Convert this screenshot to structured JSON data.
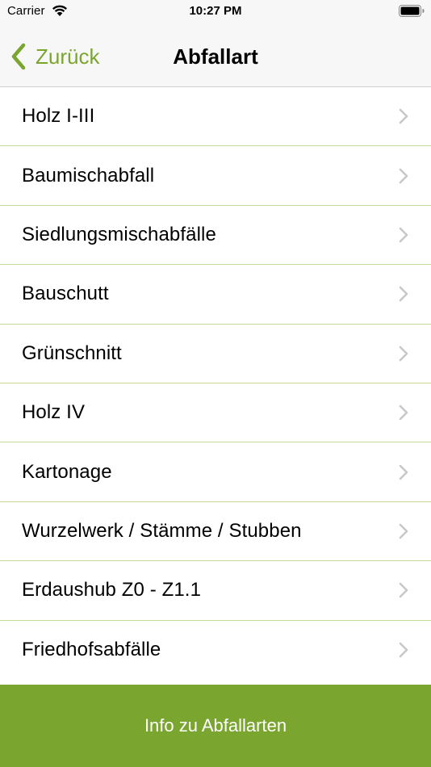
{
  "status_bar": {
    "carrier": "Carrier",
    "time": "10:27 PM",
    "icons": [
      "wifi-icon",
      "battery-icon"
    ]
  },
  "nav": {
    "back_label": "Zurück",
    "title": "Abfallart",
    "back_icon": "chevron-left-icon"
  },
  "list": {
    "items": [
      {
        "label": "Holz I-III"
      },
      {
        "label": "Baumischabfall"
      },
      {
        "label": "Siedlungsmischabfälle"
      },
      {
        "label": "Bauschutt"
      },
      {
        "label": "Grünschnitt"
      },
      {
        "label": "Holz IV"
      },
      {
        "label": "Kartonage"
      },
      {
        "label": "Wurzelwerk / Stämme / Stubben"
      },
      {
        "label": "Erdaushub Z0 - Z1.1"
      },
      {
        "label": "Friedhofsabfälle"
      }
    ],
    "item_icon": "chevron-right-icon"
  },
  "footer": {
    "button_label": "Info zu Abfallarten"
  },
  "colors": {
    "accent": "#7aa52f",
    "separator": "#c4d89b",
    "chevron": "#c7c7cc",
    "nav_background": "#f7f7f7"
  }
}
